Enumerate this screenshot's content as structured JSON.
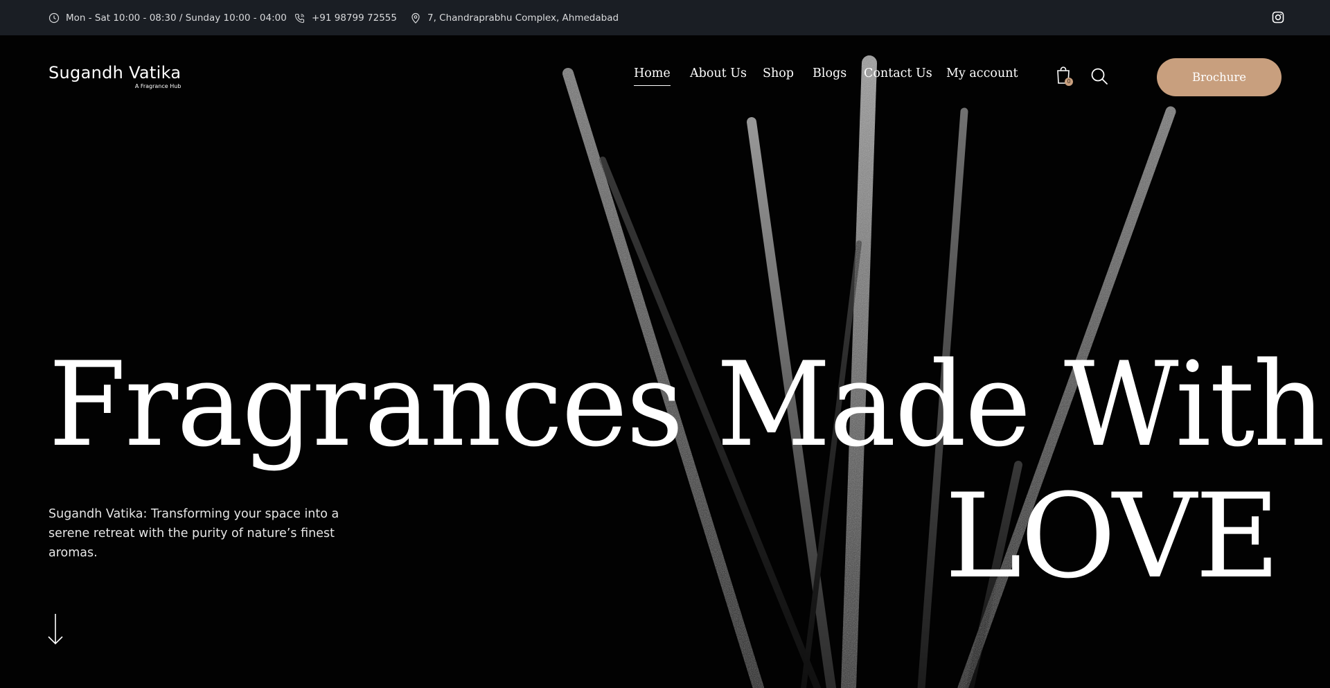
{
  "topbar": {
    "hours": "Mon - Sat 10:00 - 08:30 / Sunday 10:00 - 04:00",
    "phone": "+91 98799 72555",
    "address": "7, Chandraprabhu Complex, Ahmedabad",
    "icons": [
      "clock-icon",
      "phone-icon",
      "map-pin-icon",
      "instagram-icon"
    ]
  },
  "brand": {
    "name": "Sugandh Vatika",
    "tagline": "A Fragrance Hub"
  },
  "nav": {
    "items": [
      {
        "label": "Home",
        "active": true
      },
      {
        "label": "About Us"
      },
      {
        "label": "Shop"
      },
      {
        "label": "Blogs"
      },
      {
        "label": "Contact Us"
      },
      {
        "label": "My account"
      }
    ]
  },
  "cart": {
    "count": "0"
  },
  "brochure_label": "Brochure",
  "hero": {
    "headline_line1": "Fragrances Made With",
    "headline_line2": "LOVE",
    "intro": "Sugandh Vatika: Transforming your space into a serene retreat with the purity of nature’s finest aromas."
  },
  "colors": {
    "topbar_bg": "#1a1e24",
    "accent": "#c89f7e",
    "background": "#020202"
  }
}
